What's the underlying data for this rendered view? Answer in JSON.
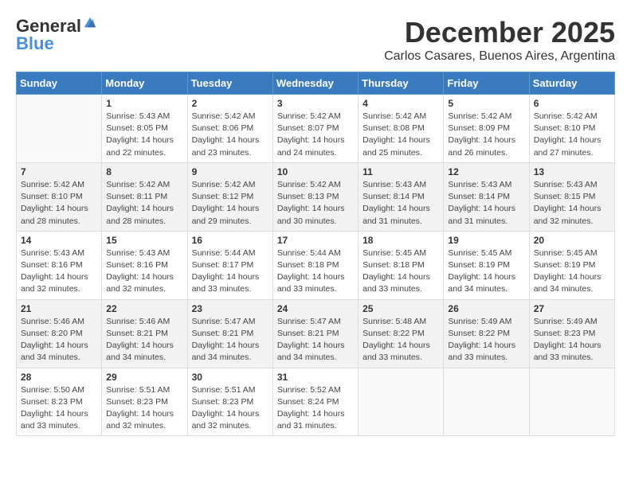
{
  "logo": {
    "general": "General",
    "blue": "Blue"
  },
  "title": "December 2025",
  "subtitle": "Carlos Casares, Buenos Aires, Argentina",
  "days_of_week": [
    "Sunday",
    "Monday",
    "Tuesday",
    "Wednesday",
    "Thursday",
    "Friday",
    "Saturday"
  ],
  "weeks": [
    [
      {
        "day": "",
        "info": ""
      },
      {
        "day": "1",
        "info": "Sunrise: 5:43 AM\nSunset: 8:05 PM\nDaylight: 14 hours\nand 22 minutes."
      },
      {
        "day": "2",
        "info": "Sunrise: 5:42 AM\nSunset: 8:06 PM\nDaylight: 14 hours\nand 23 minutes."
      },
      {
        "day": "3",
        "info": "Sunrise: 5:42 AM\nSunset: 8:07 PM\nDaylight: 14 hours\nand 24 minutes."
      },
      {
        "day": "4",
        "info": "Sunrise: 5:42 AM\nSunset: 8:08 PM\nDaylight: 14 hours\nand 25 minutes."
      },
      {
        "day": "5",
        "info": "Sunrise: 5:42 AM\nSunset: 8:09 PM\nDaylight: 14 hours\nand 26 minutes."
      },
      {
        "day": "6",
        "info": "Sunrise: 5:42 AM\nSunset: 8:10 PM\nDaylight: 14 hours\nand 27 minutes."
      }
    ],
    [
      {
        "day": "7",
        "info": "Sunrise: 5:42 AM\nSunset: 8:10 PM\nDaylight: 14 hours\nand 28 minutes."
      },
      {
        "day": "8",
        "info": "Sunrise: 5:42 AM\nSunset: 8:11 PM\nDaylight: 14 hours\nand 28 minutes."
      },
      {
        "day": "9",
        "info": "Sunrise: 5:42 AM\nSunset: 8:12 PM\nDaylight: 14 hours\nand 29 minutes."
      },
      {
        "day": "10",
        "info": "Sunrise: 5:42 AM\nSunset: 8:13 PM\nDaylight: 14 hours\nand 30 minutes."
      },
      {
        "day": "11",
        "info": "Sunrise: 5:43 AM\nSunset: 8:14 PM\nDaylight: 14 hours\nand 31 minutes."
      },
      {
        "day": "12",
        "info": "Sunrise: 5:43 AM\nSunset: 8:14 PM\nDaylight: 14 hours\nand 31 minutes."
      },
      {
        "day": "13",
        "info": "Sunrise: 5:43 AM\nSunset: 8:15 PM\nDaylight: 14 hours\nand 32 minutes."
      }
    ],
    [
      {
        "day": "14",
        "info": "Sunrise: 5:43 AM\nSunset: 8:16 PM\nDaylight: 14 hours\nand 32 minutes."
      },
      {
        "day": "15",
        "info": "Sunrise: 5:43 AM\nSunset: 8:16 PM\nDaylight: 14 hours\nand 32 minutes."
      },
      {
        "day": "16",
        "info": "Sunrise: 5:44 AM\nSunset: 8:17 PM\nDaylight: 14 hours\nand 33 minutes."
      },
      {
        "day": "17",
        "info": "Sunrise: 5:44 AM\nSunset: 8:18 PM\nDaylight: 14 hours\nand 33 minutes."
      },
      {
        "day": "18",
        "info": "Sunrise: 5:45 AM\nSunset: 8:18 PM\nDaylight: 14 hours\nand 33 minutes."
      },
      {
        "day": "19",
        "info": "Sunrise: 5:45 AM\nSunset: 8:19 PM\nDaylight: 14 hours\nand 34 minutes."
      },
      {
        "day": "20",
        "info": "Sunrise: 5:45 AM\nSunset: 8:19 PM\nDaylight: 14 hours\nand 34 minutes."
      }
    ],
    [
      {
        "day": "21",
        "info": "Sunrise: 5:46 AM\nSunset: 8:20 PM\nDaylight: 14 hours\nand 34 minutes."
      },
      {
        "day": "22",
        "info": "Sunrise: 5:46 AM\nSunset: 8:21 PM\nDaylight: 14 hours\nand 34 minutes."
      },
      {
        "day": "23",
        "info": "Sunrise: 5:47 AM\nSunset: 8:21 PM\nDaylight: 14 hours\nand 34 minutes."
      },
      {
        "day": "24",
        "info": "Sunrise: 5:47 AM\nSunset: 8:21 PM\nDaylight: 14 hours\nand 34 minutes."
      },
      {
        "day": "25",
        "info": "Sunrise: 5:48 AM\nSunset: 8:22 PM\nDaylight: 14 hours\nand 33 minutes."
      },
      {
        "day": "26",
        "info": "Sunrise: 5:49 AM\nSunset: 8:22 PM\nDaylight: 14 hours\nand 33 minutes."
      },
      {
        "day": "27",
        "info": "Sunrise: 5:49 AM\nSunset: 8:23 PM\nDaylight: 14 hours\nand 33 minutes."
      }
    ],
    [
      {
        "day": "28",
        "info": "Sunrise: 5:50 AM\nSunset: 8:23 PM\nDaylight: 14 hours\nand 33 minutes."
      },
      {
        "day": "29",
        "info": "Sunrise: 5:51 AM\nSunset: 8:23 PM\nDaylight: 14 hours\nand 32 minutes."
      },
      {
        "day": "30",
        "info": "Sunrise: 5:51 AM\nSunset: 8:23 PM\nDaylight: 14 hours\nand 32 minutes."
      },
      {
        "day": "31",
        "info": "Sunrise: 5:52 AM\nSunset: 8:24 PM\nDaylight: 14 hours\nand 31 minutes."
      },
      {
        "day": "",
        "info": ""
      },
      {
        "day": "",
        "info": ""
      },
      {
        "day": "",
        "info": ""
      }
    ]
  ]
}
